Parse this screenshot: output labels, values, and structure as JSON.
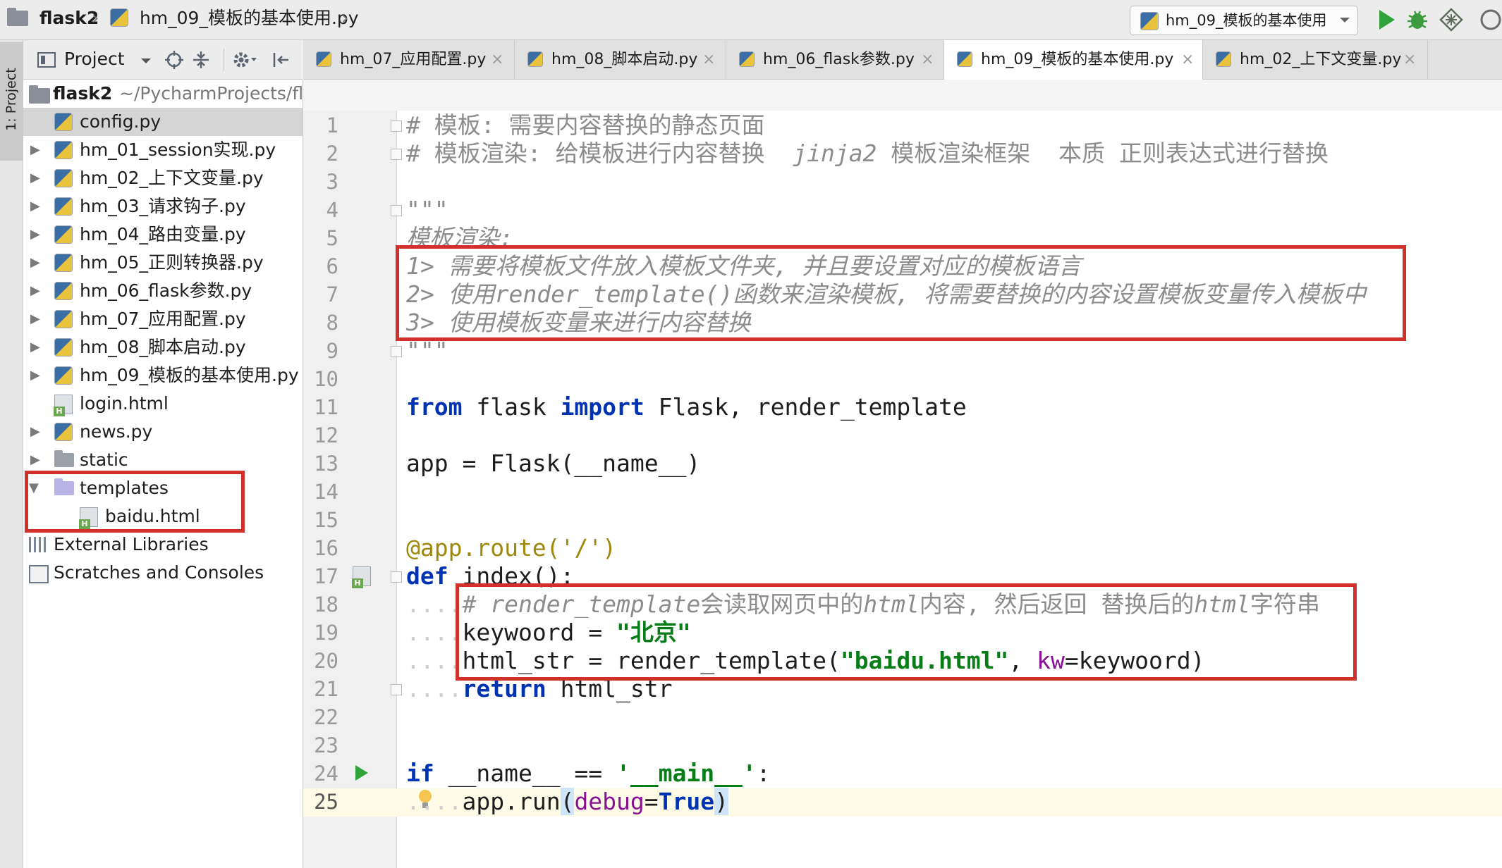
{
  "breadcrumb": {
    "project": "flask2",
    "file": "hm_09_模板的基本使用.py"
  },
  "run_config": {
    "label": "hm_09_模板的基本使用"
  },
  "tool_window_strip": {
    "label": "1: Project"
  },
  "project_panel": {
    "title": "Project",
    "root": {
      "name": "flask2",
      "path": "~/PycharmProjects/fl"
    },
    "items": [
      {
        "label": "config.py",
        "icon": "python-file-icon"
      },
      {
        "label": "hm_01_session实现.py",
        "icon": "python-file-icon"
      },
      {
        "label": "hm_02_上下文变量.py",
        "icon": "python-file-icon"
      },
      {
        "label": "hm_03_请求钩子.py",
        "icon": "python-file-icon"
      },
      {
        "label": "hm_04_路由变量.py",
        "icon": "python-file-icon"
      },
      {
        "label": "hm_05_正则转换器.py",
        "icon": "python-file-icon"
      },
      {
        "label": "hm_06_flask参数.py",
        "icon": "python-file-icon"
      },
      {
        "label": "hm_07_应用配置.py",
        "icon": "python-file-icon"
      },
      {
        "label": "hm_08_脚本启动.py",
        "icon": "python-file-icon"
      },
      {
        "label": "hm_09_模板的基本使用.py",
        "icon": "python-file-icon"
      },
      {
        "label": "login.html",
        "icon": "html-file-icon"
      },
      {
        "label": "news.py",
        "icon": "python-file-icon"
      },
      {
        "label": "static",
        "icon": "folder-icon"
      },
      {
        "label": "templates",
        "icon": "templates-folder-icon"
      },
      {
        "label": "baidu.html",
        "icon": "html-file-icon"
      },
      {
        "label": "External Libraries",
        "icon": "libraries-icon"
      },
      {
        "label": "Scratches and Consoles",
        "icon": "scratches-icon"
      }
    ]
  },
  "tabs": [
    {
      "label": "hm_07_应用配置.py",
      "active": false
    },
    {
      "label": "hm_08_脚本启动.py",
      "active": false
    },
    {
      "label": "hm_06_flask参数.py",
      "active": false
    },
    {
      "label": "hm_09_模板的基本使用.py",
      "active": true
    },
    {
      "label": "hm_02_上下文变量.py",
      "active": false
    }
  ],
  "editor": {
    "current_line": "25",
    "lines": {
      "n1": "1",
      "n2": "2",
      "n3": "3",
      "n4": "4",
      "n5": "5",
      "n6": "6",
      "n7": "7",
      "n8": "8",
      "n9": "9",
      "n10": "10",
      "n11": "11",
      "n12": "12",
      "n13": "13",
      "n14": "14",
      "n15": "15",
      "n16": "16",
      "n17": "17",
      "n18": "18",
      "n19": "19",
      "n20": "20",
      "n21": "21",
      "n22": "22",
      "n23": "23",
      "n24": "24",
      "n25": "25"
    },
    "code": {
      "l1": "# 模板: 需要内容替换的静态页面",
      "l2a": "# 模板渲染: 给模板进行内容替换  ",
      "l2b": "jinja2",
      "l2c": " 模板渲染框架  本质 正则表达式进行替换",
      "l4": "\"\"\"",
      "l5": "模板渲染:",
      "l6": "1> 需要将模板文件放入模板文件夹, 并且要设置对应的模板语言",
      "l7a": "2> 使用",
      "l7b": "render_template()",
      "l7c": "函数来渲染模板, 将需要替换的内容设置模板变量传入模板中",
      "l8": "3> 使用模板变量来进行内容替换",
      "l9": "\"\"\"",
      "l11_from": "from",
      "l11_mid": " flask ",
      "l11_import": "import",
      "l11_rest": " Flask, render_template",
      "l13": "app = Flask(__name__)",
      "l16": "@app.route('/')",
      "l17_def": "def",
      "l17_rest": " index():",
      "l18_indent": "....",
      "l18a": "# render_template",
      "l18b": "会读取网页中的",
      "l18c": "html",
      "l18d": "内容, 然后返回 替换后的",
      "l18e": "html",
      "l18f": "字符串",
      "l19_indent": "....",
      "l19_var": "keywoord = ",
      "l19_str": "\"北京\"",
      "l20_indent": "....",
      "l20_a": "html_str = render_template(",
      "l20_str": "\"baidu.html\"",
      "l20_b": ", ",
      "l20_kw": "kw",
      "l20_c": "=keywoord)",
      "l21_indent": "....",
      "l21_ret": "return",
      "l21_rest": " html_str",
      "l24_if": "if",
      "l24_a": " __name__ == ",
      "l24_str": "'__main__'",
      "l24_b": ":",
      "l25_indent": "....",
      "l25_a": "app.run",
      "l25_paren1": "(",
      "l25_param": "debug",
      "l25_eq": "=",
      "l25_true": "True",
      "l25_paren2": ")"
    }
  },
  "colors": {
    "highlight_box": "#d0312d",
    "keyword": "#0033b3",
    "string": "#067d17",
    "comment": "#8c8c8c",
    "decorator": "#9e880d",
    "param": "#871094"
  }
}
